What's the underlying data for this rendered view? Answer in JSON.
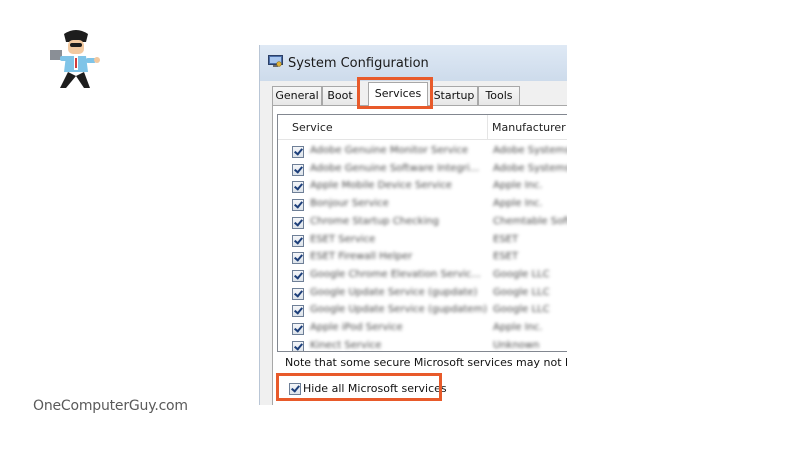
{
  "brand": {
    "site": "OneComputerGuy.com"
  },
  "window": {
    "title": "System Configuration"
  },
  "tabs": [
    {
      "label": "General"
    },
    {
      "label": "Boot"
    },
    {
      "label": "Services",
      "active": true
    },
    {
      "label": "Startup"
    },
    {
      "label": "Tools"
    }
  ],
  "table": {
    "columns": {
      "service": "Service",
      "manufacturer": "Manufacturer"
    },
    "rows": [
      {
        "service": "Adobe Genuine Monitor Service",
        "manufacturer": "Adobe Systems",
        "checked": true
      },
      {
        "service": "Adobe Genuine Software Integri...",
        "manufacturer": "Adobe Systems",
        "checked": true
      },
      {
        "service": "Apple Mobile Device Service",
        "manufacturer": "Apple Inc.",
        "checked": true
      },
      {
        "service": "Bonjour Service",
        "manufacturer": "Apple Inc.",
        "checked": true
      },
      {
        "service": "Chrome Startup Checking",
        "manufacturer": "Chemtable Soft",
        "checked": true
      },
      {
        "service": "ESET Service",
        "manufacturer": "ESET",
        "checked": true
      },
      {
        "service": "ESET Firewall Helper",
        "manufacturer": "ESET",
        "checked": true
      },
      {
        "service": "Google Chrome Elevation Servic...",
        "manufacturer": "Google LLC",
        "checked": true
      },
      {
        "service": "Google Update Service (gupdate)",
        "manufacturer": "Google LLC",
        "checked": true
      },
      {
        "service": "Google Update Service (gupdatem)",
        "manufacturer": "Google LLC",
        "checked": true
      },
      {
        "service": "Apple iPod Service",
        "manufacturer": "Apple Inc.",
        "checked": true
      },
      {
        "service": "Kinect Service",
        "manufacturer": "Unknown",
        "checked": true
      }
    ]
  },
  "note": "Note that some secure Microsoft services may not be dis",
  "hide_ms": {
    "label": "Hide all Microsoft services",
    "checked": true
  },
  "colors": {
    "highlight": "#e85a2a",
    "accent": "#1d3f7a"
  }
}
